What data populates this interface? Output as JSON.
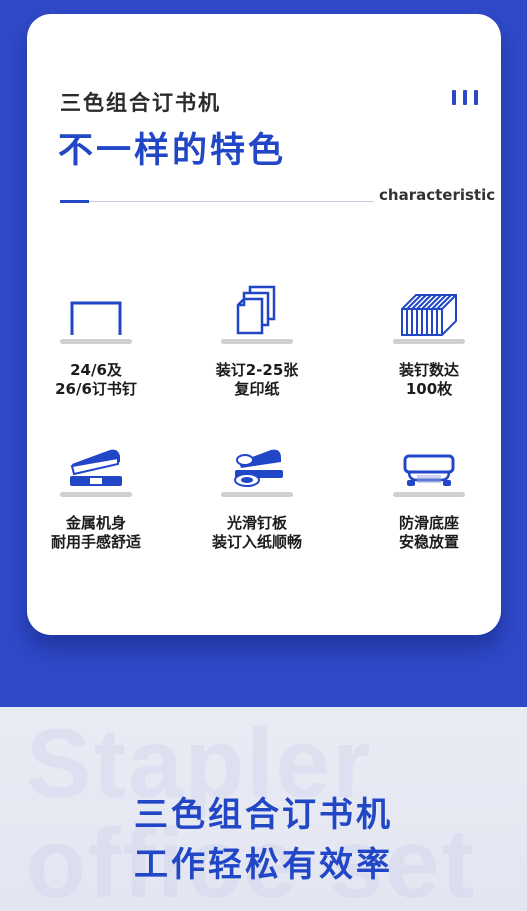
{
  "header": {
    "subtitle": "三色组合订书机",
    "title": "不一样的特色",
    "english_label": "characteristic"
  },
  "features": [
    {
      "icon": "staple-icon",
      "line1": "24/6及",
      "line2": "26/6订书钉"
    },
    {
      "icon": "paper-stack-icon",
      "line1": "装订2-25张",
      "line2": "复印纸"
    },
    {
      "icon": "staple-strip-icon",
      "line1": "装钉数达",
      "line2": "100枚"
    },
    {
      "icon": "stapler-body-icon",
      "line1": "金属机身",
      "line2": "耐用手感舒适"
    },
    {
      "icon": "stapler-anvil-icon",
      "line1": "光滑钉板",
      "line2": "装订入纸顺畅"
    },
    {
      "icon": "non-slip-base-icon",
      "line1": "防滑底座",
      "line2": "安稳放置"
    }
  ],
  "bottom": {
    "watermark_line1": "Stapler",
    "watermark_line2": "office set",
    "line1": "三色组合订书机",
    "line2": "工作轻松有效率"
  },
  "colors": {
    "brand_blue": "#2146c6",
    "background_blue": "#2f49c8",
    "card": "#ffffff",
    "bottom_panel": "#e6e8f3"
  }
}
